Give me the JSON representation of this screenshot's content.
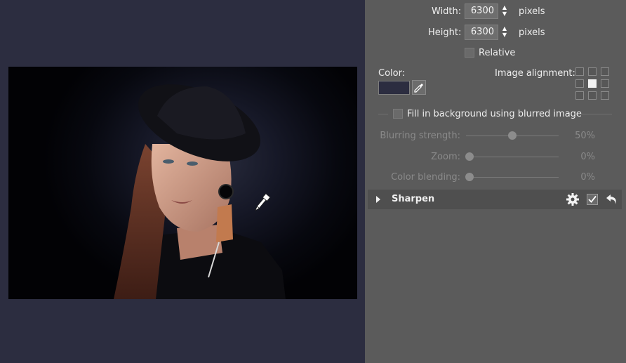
{
  "size": {
    "width_label": "Width:",
    "width_value": "6300",
    "height_label": "Height:",
    "height_value": "6300",
    "unit": "pixels",
    "relative_label": "Relative"
  },
  "color": {
    "label": "Color:",
    "swatch_color": "#2c2d40",
    "picker_icon": "eyedropper-icon"
  },
  "alignment": {
    "label": "Image alignment:",
    "selected": "center"
  },
  "fill": {
    "label": "Fill in background using blurred image",
    "blurring_label": "Blurring strength:",
    "blurring_value": "50%",
    "blurring_level": 0.5,
    "zoom_label": "Zoom:",
    "zoom_value": "0%",
    "zoom_level": 0,
    "blending_label": "Color blending:",
    "blending_value": "0%",
    "blending_level": 0
  },
  "sharpen": {
    "title": "Sharpen",
    "settings_icon": "gear-icon",
    "enabled_icon": "checkmark-icon",
    "reset_icon": "undo-icon"
  },
  "colors": {
    "canvas_bg": "#2c2d40",
    "panel_bg": "#5b5b5b"
  }
}
